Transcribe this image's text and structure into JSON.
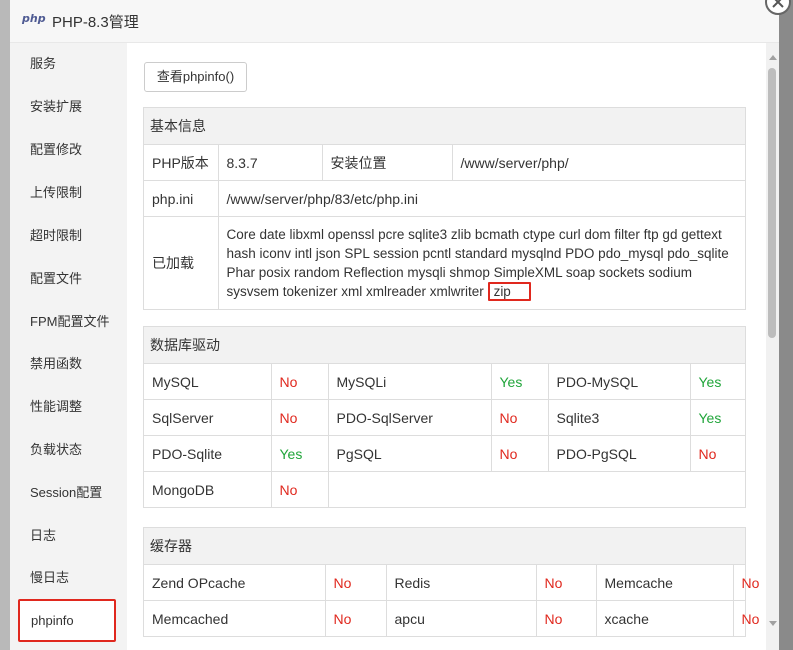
{
  "window": {
    "logo": "php",
    "title": "PHP-8.3管理"
  },
  "sidebar": {
    "items": [
      {
        "label": "服务"
      },
      {
        "label": "安装扩展"
      },
      {
        "label": "配置修改"
      },
      {
        "label": "上传限制"
      },
      {
        "label": "超时限制"
      },
      {
        "label": "配置文件"
      },
      {
        "label": "FPM配置文件"
      },
      {
        "label": "禁用函数"
      },
      {
        "label": "性能调整"
      },
      {
        "label": "负载状态"
      },
      {
        "label": "Session配置"
      },
      {
        "label": "日志"
      },
      {
        "label": "慢日志"
      },
      {
        "label": "phpinfo"
      }
    ],
    "active": "phpinfo"
  },
  "toolbar": {
    "phpinfo_button": "查看phpinfo()"
  },
  "basic_info": {
    "title": "基本信息",
    "php_version_label": "PHP版本",
    "php_version": "8.3.7",
    "install_path_label": "安装位置",
    "install_path": "/www/server/php/",
    "php_ini_label": "php.ini",
    "php_ini": "/www/server/php/83/etc/php.ini",
    "loaded_label": "已加载",
    "loaded_extensions": "Core date libxml openssl pcre sqlite3 zlib bcmath ctype curl dom filter ftp gd gettext hash iconv intl json SPL session pcntl standard mysqlnd PDO pdo_mysql pdo_sqlite Phar posix random Reflection mysqli shmop SimpleXML soap sockets sodium sysvsem tokenizer xml xmlreader xmlwriter",
    "highlighted_extension": "zip"
  },
  "db_drivers": {
    "title": "数据库驱动",
    "rows": [
      [
        {
          "name": "MySQL",
          "status": "No"
        },
        {
          "name": "MySQLi",
          "status": "Yes"
        },
        {
          "name": "PDO-MySQL",
          "status": "Yes"
        }
      ],
      [
        {
          "name": "SqlServer",
          "status": "No"
        },
        {
          "name": "PDO-SqlServer",
          "status": "No"
        },
        {
          "name": "Sqlite3",
          "status": "Yes"
        }
      ],
      [
        {
          "name": "PDO-Sqlite",
          "status": "Yes"
        },
        {
          "name": "PgSQL",
          "status": "No"
        },
        {
          "name": "PDO-PgSQL",
          "status": "No"
        }
      ],
      [
        {
          "name": "MongoDB",
          "status": "No"
        }
      ]
    ]
  },
  "cache": {
    "title": "缓存器",
    "rows": [
      [
        {
          "name": "Zend OPcache",
          "status": "No"
        },
        {
          "name": "Redis",
          "status": "No"
        },
        {
          "name": "Memcache",
          "status": "No"
        }
      ],
      [
        {
          "name": "Memcached",
          "status": "No"
        },
        {
          "name": "apcu",
          "status": "No"
        },
        {
          "name": "xcache",
          "status": "No"
        }
      ]
    ]
  },
  "colors": {
    "no": "#e0281e",
    "yes": "#20a53a",
    "highlight": "#e0281e"
  }
}
